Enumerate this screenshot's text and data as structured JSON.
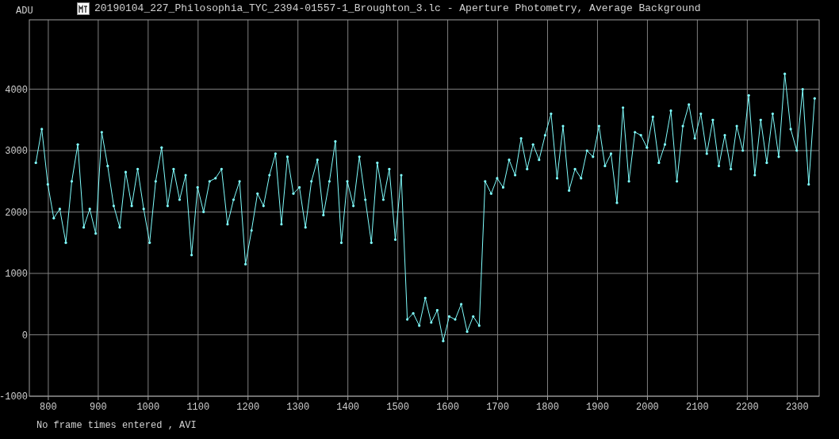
{
  "window": {
    "title": "20190104_227_Philosophia_TYC_2394-01557-1_Broughton_3.lc - Aperture Photometry, Average Background"
  },
  "plot": {
    "chart_data": {
      "type": "line",
      "ylabel": "ADU",
      "x": [
        775,
        787,
        799,
        811,
        823,
        835,
        847,
        859,
        871,
        883,
        895,
        907,
        919,
        931,
        943,
        955,
        967,
        979,
        991,
        1003,
        1015,
        1027,
        1039,
        1051,
        1063,
        1075,
        1087,
        1099,
        1111,
        1123,
        1135,
        1147,
        1159,
        1171,
        1183,
        1195,
        1207,
        1219,
        1231,
        1243,
        1255,
        1267,
        1279,
        1291,
        1303,
        1315,
        1327,
        1339,
        1351,
        1363,
        1375,
        1387,
        1399,
        1411,
        1423,
        1435,
        1447,
        1459,
        1471,
        1483,
        1495,
        1507,
        1519,
        1531,
        1543,
        1555,
        1567,
        1579,
        1591,
        1603,
        1615,
        1627,
        1639,
        1651,
        1663,
        1675,
        1687,
        1699,
        1711,
        1723,
        1735,
        1747,
        1759,
        1771,
        1783,
        1795,
        1807,
        1819,
        1831,
        1843,
        1855,
        1867,
        1879,
        1891,
        1903,
        1915,
        1927,
        1939,
        1951,
        1963,
        1975,
        1987,
        1999,
        2011,
        2023,
        2035,
        2047,
        2059,
        2071,
        2083,
        2095,
        2107,
        2119,
        2131,
        2143,
        2155,
        2167,
        2179,
        2191,
        2203,
        2215,
        2227,
        2239,
        2251,
        2263,
        2275,
        2287,
        2299,
        2311,
        2323,
        2335
      ],
      "series": [
        {
          "color": "#80ffff",
          "values": [
            2800,
            3350,
            2450,
            1900,
            2050,
            1500,
            2500,
            3100,
            1750,
            2050,
            1650,
            3300,
            2750,
            2100,
            1750,
            2650,
            2100,
            2700,
            2050,
            1500,
            2500,
            3050,
            2100,
            2700,
            2200,
            2600,
            1300,
            2400,
            2000,
            2500,
            2550,
            2700,
            1800,
            2200,
            2500,
            1150,
            1700,
            2300,
            2100,
            2600,
            2950,
            1800,
            2900,
            2300,
            2400,
            1750,
            2500,
            2850,
            1950,
            2500,
            3150,
            1500,
            2500,
            2100,
            2900,
            2200,
            1500,
            2800,
            2200,
            2700,
            1550,
            2600,
            250,
            350,
            150,
            600,
            200,
            400,
            -100,
            300,
            250,
            500,
            50,
            300,
            150,
            2500,
            2300,
            2550,
            2400,
            2850,
            2600,
            3200,
            2700,
            3100,
            2850,
            3250,
            3600,
            2550,
            3400,
            2350,
            2700,
            2550,
            3000,
            2900,
            3400,
            2750,
            2950,
            2150,
            3700,
            2500,
            3300,
            3250,
            3050,
            3550,
            2800,
            3100,
            3650,
            2500,
            3400,
            3750,
            3200,
            3600,
            2950,
            3500,
            2750,
            3250,
            2700,
            3400,
            3000,
            3900,
            2600,
            3500,
            2800,
            3600,
            2900,
            4250,
            3350,
            3000,
            4000,
            2450,
            3850
          ]
        }
      ],
      "xlim": [
        762,
        2344
      ],
      "ylim": [
        -1000,
        5130
      ],
      "xticks": [
        800,
        900,
        1000,
        1100,
        1200,
        1300,
        1400,
        1500,
        1600,
        1700,
        1800,
        1900,
        2000,
        2100,
        2200,
        2300
      ],
      "yticks": [
        -1000,
        0,
        1000,
        2000,
        3000,
        4000
      ],
      "grid": true
    }
  },
  "status_text": "No frame times entered , AVI"
}
